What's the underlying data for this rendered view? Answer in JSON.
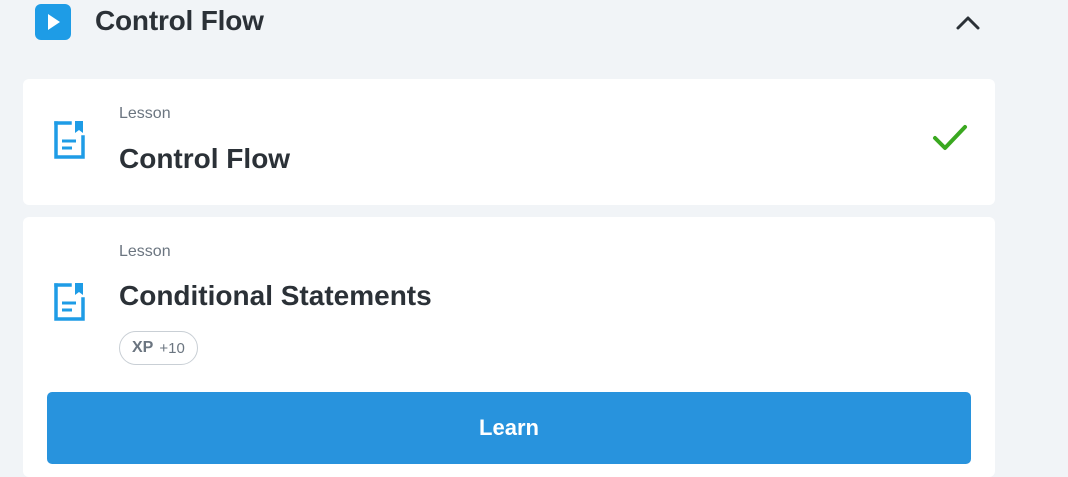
{
  "colors": {
    "accent": "#1e9ce6",
    "button": "#2893dd",
    "success": "#3aa820",
    "background": "#f1f4f7",
    "card": "#ffffff",
    "text": "#2b3137",
    "muted": "#6b7580"
  },
  "section": {
    "title": "Control Flow",
    "play_icon": "play-icon",
    "collapse_icon": "chevron-up-icon"
  },
  "lessons": [
    {
      "kicker": "Lesson",
      "title": "Control Flow",
      "icon": "lesson-document-icon",
      "status_icon": "checkmark-icon",
      "completed": true
    },
    {
      "kicker": "Lesson",
      "title": "Conditional Statements",
      "icon": "lesson-document-icon",
      "xp_label": "XP",
      "xp_value": "+10",
      "button_label": "Learn"
    }
  ]
}
